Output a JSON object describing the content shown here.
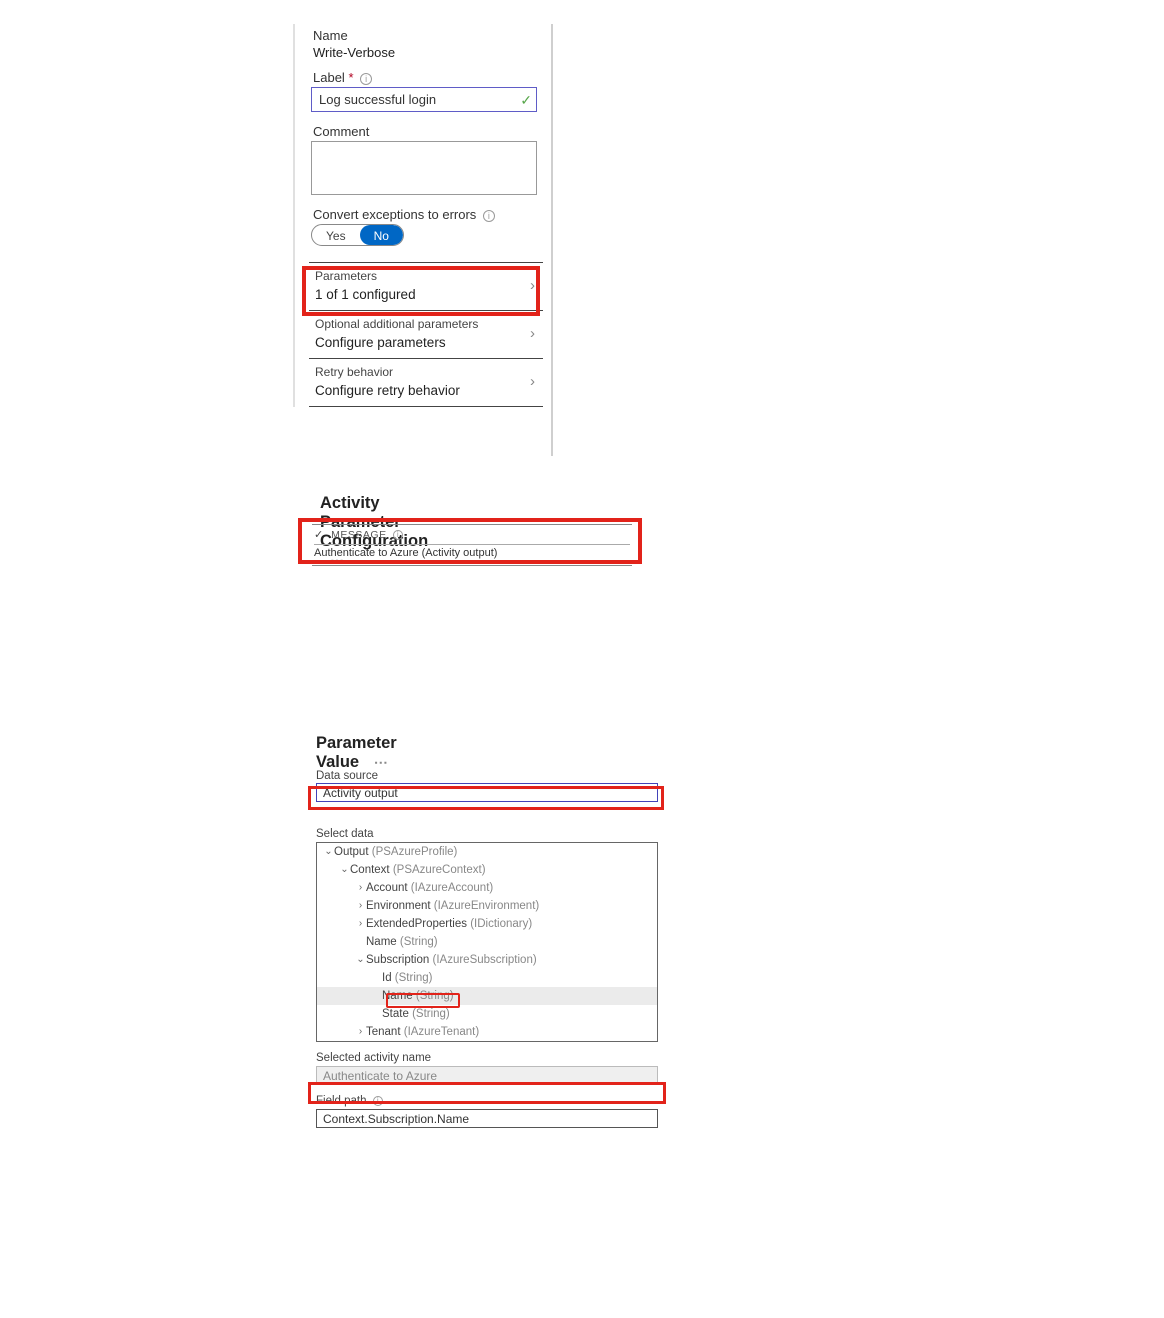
{
  "panel1": {
    "name_label": "Name",
    "name_value": "Write-Verbose",
    "label_label": "Label",
    "label_required": "*",
    "label_value": "Log successful login",
    "comment_label": "Comment",
    "convert_label": "Convert exceptions to errors",
    "toggle_yes": "Yes",
    "toggle_no": "No",
    "param_label": "Parameters",
    "param_sub": "1 of 1 configured",
    "optional_label": "Optional additional parameters",
    "optional_sub": "Configure parameters",
    "retry_label": "Retry behavior",
    "retry_sub": "Configure retry behavior"
  },
  "panel2": {
    "title": "Activity Parameter Configuration",
    "msg_header": "MESSAGE",
    "msg_value": "Authenticate to Azure (Activity output)"
  },
  "panel3": {
    "title": "Parameter Value",
    "ds_label": "Data source",
    "ds_value": "Activity output",
    "select_label": "Select data",
    "selected_name_label": "Selected activity name",
    "selected_name_value": "Authenticate to Azure",
    "field_path_label": "Field path",
    "field_path_value": "Context.Subscription.Name"
  },
  "tree": {
    "n1a": "Output",
    "n1b": "(PSAzureProfile)",
    "n2a": "Context",
    "n2b": "(PSAzureContext)",
    "n3a": "Account",
    "n3b": "(IAzureAccount)",
    "n4a": "Environment",
    "n4b": "(IAzureEnvironment)",
    "n5a": "ExtendedProperties",
    "n5b": "(IDictionary)",
    "n6a": "Name",
    "n6b": "(String)",
    "n7a": "Subscription",
    "n7b": "(IAzureSubscription)",
    "n8a": "Id",
    "n8b": "(String)",
    "n9a": "Name",
    "n9b": "(String)",
    "n10a": "State",
    "n10b": "(String)",
    "n11a": "Tenant",
    "n11b": "(IAzureTenant)"
  }
}
